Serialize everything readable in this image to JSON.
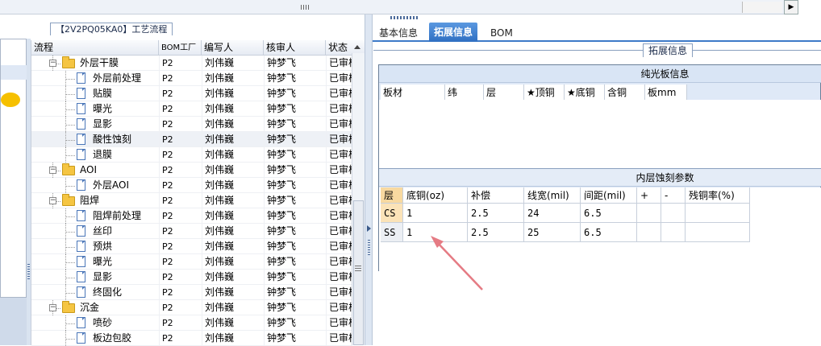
{
  "tree": {
    "title": "【2V2PQ05KA0】工艺流程",
    "columns": [
      "流程",
      "BOM工厂",
      "编写人",
      "核审人",
      "状态"
    ],
    "rows": [
      {
        "name": "外层干膜",
        "type": "folder",
        "level": 1,
        "bom": "P2",
        "writer": "刘伟巍",
        "reviewer": "钟梦飞",
        "status": "已审核"
      },
      {
        "name": "外层前处理",
        "type": "doc",
        "level": 2,
        "bom": "P2",
        "writer": "刘伟巍",
        "reviewer": "钟梦飞",
        "status": "已审核"
      },
      {
        "name": "贴膜",
        "type": "doc",
        "level": 2,
        "bom": "P2",
        "writer": "刘伟巍",
        "reviewer": "钟梦飞",
        "status": "已审核"
      },
      {
        "name": "曝光",
        "type": "doc",
        "level": 2,
        "bom": "P2",
        "writer": "刘伟巍",
        "reviewer": "钟梦飞",
        "status": "已审核"
      },
      {
        "name": "显影",
        "type": "doc",
        "level": 2,
        "bom": "P2",
        "writer": "刘伟巍",
        "reviewer": "钟梦飞",
        "status": "已审核"
      },
      {
        "name": "酸性蚀刻",
        "type": "doc",
        "level": 2,
        "bom": "P2",
        "writer": "刘伟巍",
        "reviewer": "钟梦飞",
        "status": "已审核",
        "selected": true
      },
      {
        "name": "退膜",
        "type": "doc",
        "level": 2,
        "bom": "P2",
        "writer": "刘伟巍",
        "reviewer": "钟梦飞",
        "status": "已审核"
      },
      {
        "name": "AOI",
        "type": "folder",
        "level": 1,
        "bom": "P2",
        "writer": "刘伟巍",
        "reviewer": "钟梦飞",
        "status": "已审核"
      },
      {
        "name": "外层AOI",
        "type": "doc",
        "level": 2,
        "bom": "P2",
        "writer": "刘伟巍",
        "reviewer": "钟梦飞",
        "status": "已审核"
      },
      {
        "name": "阻焊",
        "type": "folder",
        "level": 1,
        "bom": "P2",
        "writer": "刘伟巍",
        "reviewer": "钟梦飞",
        "status": "已审核"
      },
      {
        "name": "阻焊前处理",
        "type": "doc",
        "level": 2,
        "bom": "P2",
        "writer": "刘伟巍",
        "reviewer": "钟梦飞",
        "status": "已审核"
      },
      {
        "name": "丝印",
        "type": "doc",
        "level": 2,
        "bom": "P2",
        "writer": "刘伟巍",
        "reviewer": "钟梦飞",
        "status": "已审核"
      },
      {
        "name": "预烘",
        "type": "doc",
        "level": 2,
        "bom": "P2",
        "writer": "刘伟巍",
        "reviewer": "钟梦飞",
        "status": "已审核"
      },
      {
        "name": "曝光",
        "type": "doc",
        "level": 2,
        "bom": "P2",
        "writer": "刘伟巍",
        "reviewer": "钟梦飞",
        "status": "已审核"
      },
      {
        "name": "显影",
        "type": "doc",
        "level": 2,
        "bom": "P2",
        "writer": "刘伟巍",
        "reviewer": "钟梦飞",
        "status": "已审核"
      },
      {
        "name": "终固化",
        "type": "doc",
        "level": 2,
        "bom": "P2",
        "writer": "刘伟巍",
        "reviewer": "钟梦飞",
        "status": "已审核"
      },
      {
        "name": "沉金",
        "type": "folder",
        "level": 1,
        "bom": "P2",
        "writer": "刘伟巍",
        "reviewer": "钟梦飞",
        "status": "已审核"
      },
      {
        "name": "喷砂",
        "type": "doc",
        "level": 2,
        "bom": "P2",
        "writer": "刘伟巍",
        "reviewer": "钟梦飞",
        "status": "已审核"
      },
      {
        "name": "板边包胶",
        "type": "doc",
        "level": 2,
        "bom": "P2",
        "writer": "刘伟巍",
        "reviewer": "钟梦飞",
        "status": "已审核"
      }
    ]
  },
  "tabs": [
    {
      "label": "基本信息",
      "active": false
    },
    {
      "label": "拓展信息",
      "active": true
    },
    {
      "label": "BOM",
      "active": false
    }
  ],
  "ext": {
    "legend": "拓展信息",
    "board": {
      "title": "纯光板信息",
      "columns": [
        "板材",
        "纬",
        "层",
        "★顶铜",
        "★底铜",
        "含铜",
        "板mm"
      ]
    },
    "etch": {
      "title": "内层蚀刻参数",
      "columns": [
        "层",
        "底铜(oz)",
        "补偿",
        "线宽(mil)",
        "间距(mil)",
        "+",
        "-",
        "残铜率(%)"
      ],
      "rows": [
        [
          "CS",
          "1",
          "2.5",
          "24",
          "6.5",
          "",
          "",
          ""
        ],
        [
          "SS",
          "1",
          "2.5",
          "25",
          "6.5",
          "",
          "",
          ""
        ]
      ]
    }
  },
  "colors": {
    "accent": "#3d7ac8",
    "annotation_arrow": "#e57b84"
  }
}
